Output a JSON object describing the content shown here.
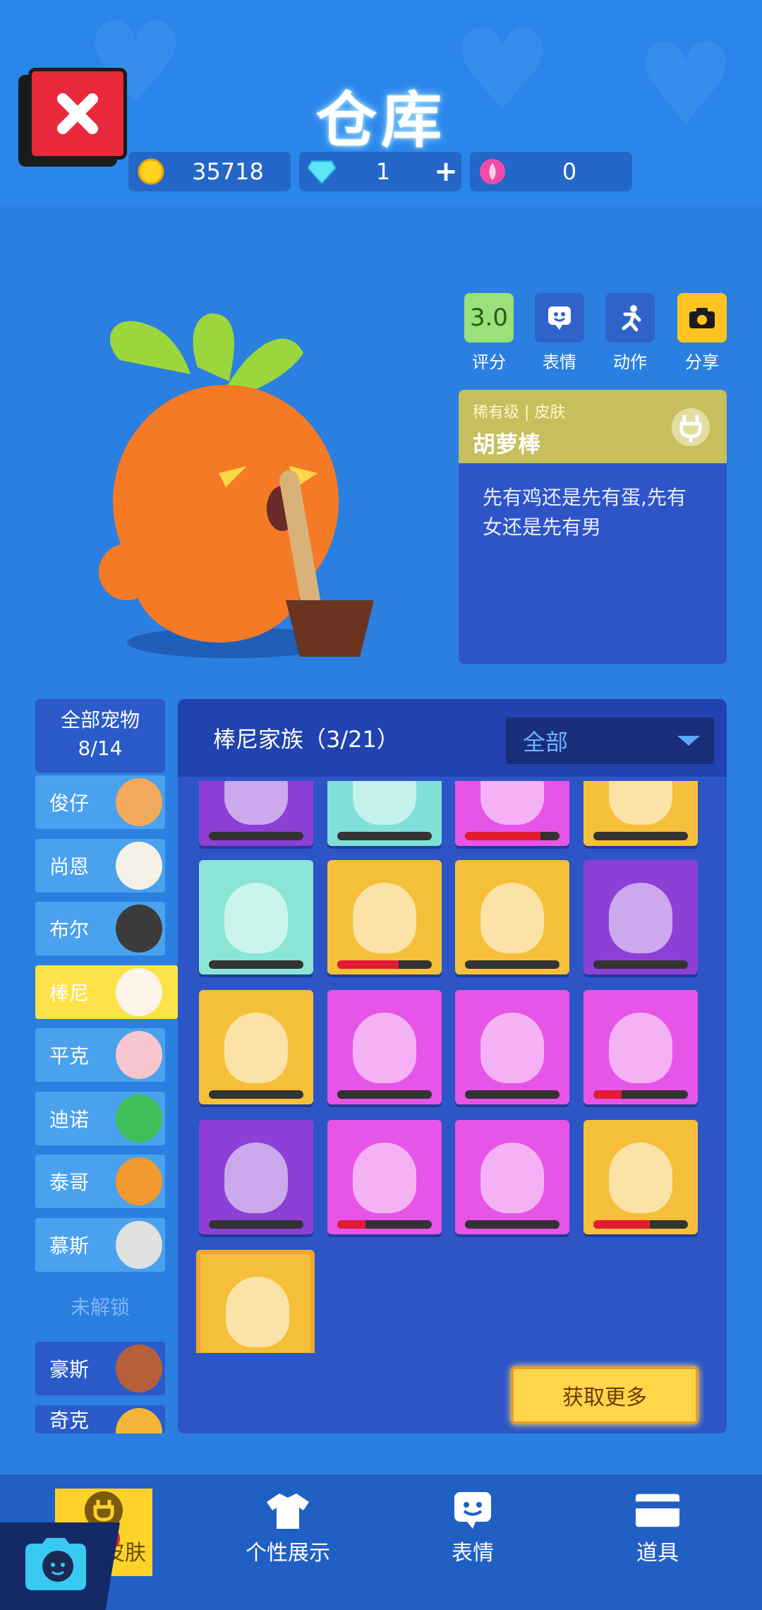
{
  "header": {
    "title": "仓库",
    "coins": "35718",
    "gems": "1",
    "gems_add": "+",
    "lotus": "0"
  },
  "actions": [
    {
      "icon": "rating-icon",
      "value": "3.0",
      "label": "评分"
    },
    {
      "icon": "emote-icon",
      "label": "表情"
    },
    {
      "icon": "action-run-icon",
      "label": "动作"
    },
    {
      "icon": "camera-icon",
      "label": "分享"
    }
  ],
  "skin": {
    "rarity": "稀有级",
    "type": "皮肤",
    "name": "胡萝棒",
    "description": "先有鸡还是先有蛋,先有女还是先有男"
  },
  "pets": {
    "all_label": "全部宠物",
    "count": "8/14",
    "items": [
      {
        "name": "俊仔",
        "face": "#F2A95C"
      },
      {
        "name": "尚恩",
        "face": "#F4F1E6"
      },
      {
        "name": "布尔",
        "face": "#3B3B3B"
      },
      {
        "name": "棒尼",
        "face": "#FFF4E8"
      },
      {
        "name": "平克",
        "face": "#F8C6D0"
      },
      {
        "name": "迪诺",
        "face": "#3FBF5C"
      },
      {
        "name": "泰哥",
        "face": "#F29A2E"
      },
      {
        "name": "慕斯",
        "face": "#E0E0E0"
      }
    ],
    "locked_label": "未解锁",
    "locked_items": [
      {
        "name": "豪斯",
        "face": "#B5603A"
      },
      {
        "name": "奇克",
        "face": "#F4B63A"
      }
    ]
  },
  "family": {
    "title": "棒尼家族（3/21）",
    "filter": "全部",
    "get_more": "获取更多",
    "cards": [
      {
        "color": "#8E3FD6",
        "progress": 0
      },
      {
        "color": "#7FE0D8",
        "progress": 0
      },
      {
        "color": "#E655E8",
        "progress": 0.8
      },
      {
        "color": "#F5BF3A",
        "progress": 0
      },
      {
        "color": "#8AE5D5",
        "progress": 0
      },
      {
        "color": "#F5BF3A",
        "progress": 0.65
      },
      {
        "color": "#F5BF3A",
        "progress": 0
      },
      {
        "color": "#8E3FD6",
        "progress": 0
      },
      {
        "color": "#F5BF3A",
        "progress": 0
      },
      {
        "color": "#E655E8",
        "progress": 0
      },
      {
        "color": "#E655E8",
        "progress": 0
      },
      {
        "color": "#E655E8",
        "progress": 0.3
      },
      {
        "color": "#8E3FD6",
        "progress": 0
      },
      {
        "color": "#E655E8",
        "progress": 0.3
      },
      {
        "color": "#E655E8",
        "progress": 0
      },
      {
        "color": "#F5BF3A",
        "progress": 0.6
      },
      {
        "color": "#F5BF3A",
        "progress": 0
      }
    ]
  },
  "nav": [
    {
      "icon": "plug-icon",
      "label": "宠物皮肤"
    },
    {
      "icon": "tshirt-icon",
      "label": "个性展示"
    },
    {
      "icon": "emote-icon",
      "label": "表情"
    },
    {
      "icon": "card-icon",
      "label": "道具"
    }
  ]
}
